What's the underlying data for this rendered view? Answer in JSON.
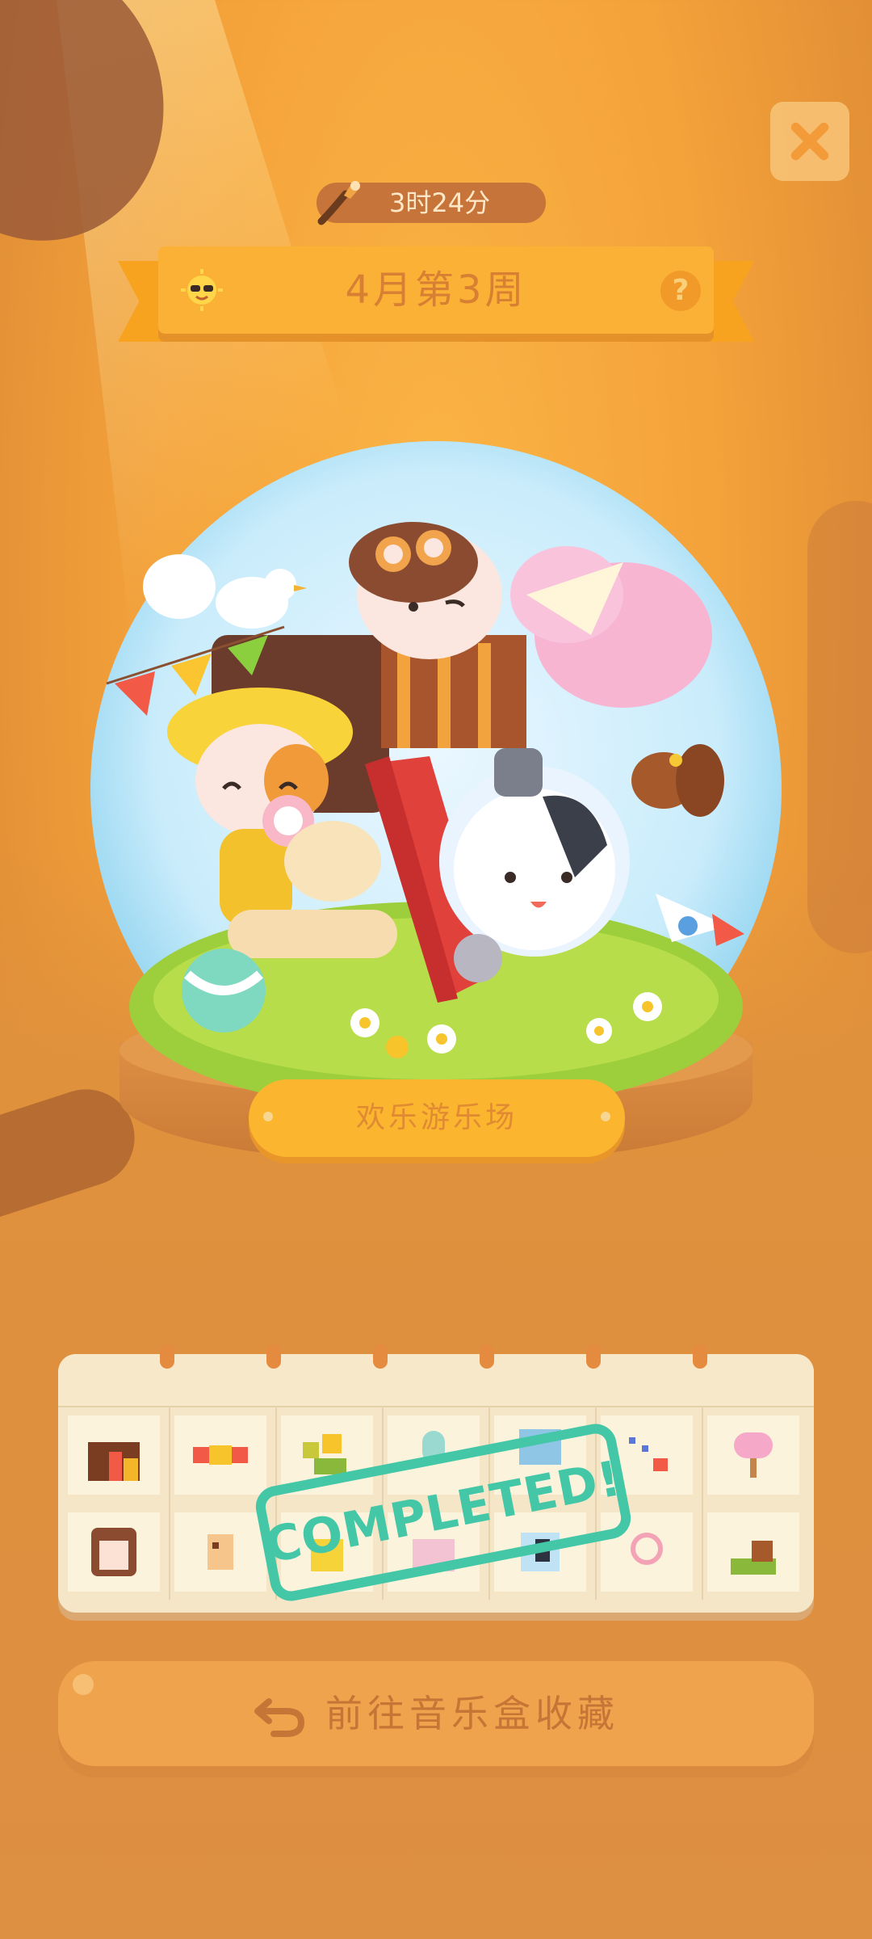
{
  "timer": {
    "icon": "paintbrush-icon",
    "text": "3时24分"
  },
  "banner": {
    "title": "4月第3周",
    "left_icon": "sun-sunglasses-icon",
    "help_label": "?"
  },
  "close": {
    "icon": "close-icon"
  },
  "globe": {
    "plaque_text": "欢乐游乐场"
  },
  "stickers": {
    "row1": [
      "house-sticker",
      "candy-sticker",
      "flower-sticker",
      "balloon-sticker",
      "window-sticker",
      "sparkle-sticker",
      "tree-sticker"
    ],
    "row2": [
      "girl-sticker",
      "dog-sticker",
      "duck-sticker",
      "paper-sticker",
      "cat-sticker",
      "lollipop-sticker",
      "squirrel-sticker"
    ],
    "stamp_text": "COMPLETED!"
  },
  "footer": {
    "button_label": "前往音乐盒收藏",
    "icon": "return-arrow-icon"
  },
  "colors": {
    "stamp": "#43c7a7",
    "banner": "#fbb036",
    "button": "#f0a34d"
  }
}
